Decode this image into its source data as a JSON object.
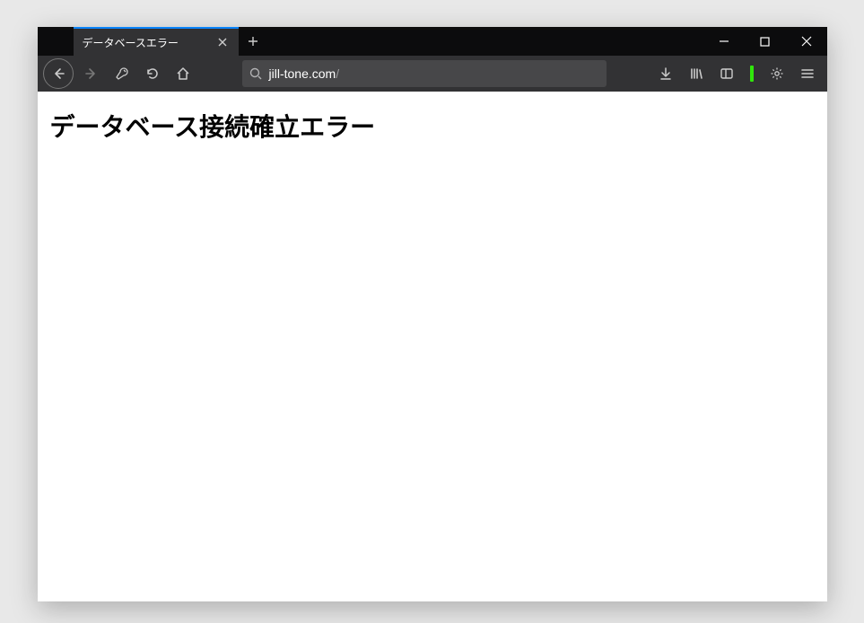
{
  "tab": {
    "title": "データベースエラー"
  },
  "addressbar": {
    "host": "jill-tone.com",
    "path": "/"
  },
  "page": {
    "heading": "データベース接続確立エラー"
  }
}
